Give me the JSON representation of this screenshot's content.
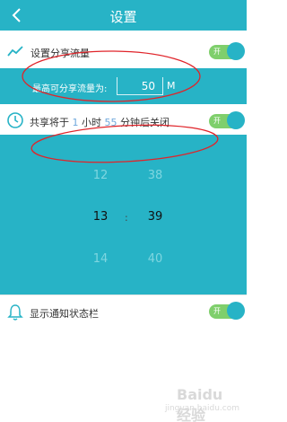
{
  "header": {
    "title": "设置"
  },
  "share_traffic": {
    "label": "设置分享流量",
    "toggle_text": "开"
  },
  "cap": {
    "label": "最高可分享流量为:",
    "value": "50",
    "unit": "M"
  },
  "timer": {
    "prefix": "共享将于",
    "hours": "1",
    "hours_unit": "小时",
    "minutes": "55",
    "suffix": "分钟后关闭",
    "toggle_text": "开"
  },
  "picker": {
    "hours": [
      "12",
      "13",
      "14"
    ],
    "minutes": [
      "38",
      "39",
      "40"
    ],
    "separator": ":"
  },
  "notification": {
    "label": "显示通知状态栏",
    "toggle_text": "开"
  },
  "watermark": {
    "main": "Baidu 经验",
    "sub": "jingyan.baidu.com"
  },
  "colors": {
    "accent": "#27b3c6",
    "toggle_on": "#7fcf6c",
    "annotation": "#e0242a"
  }
}
